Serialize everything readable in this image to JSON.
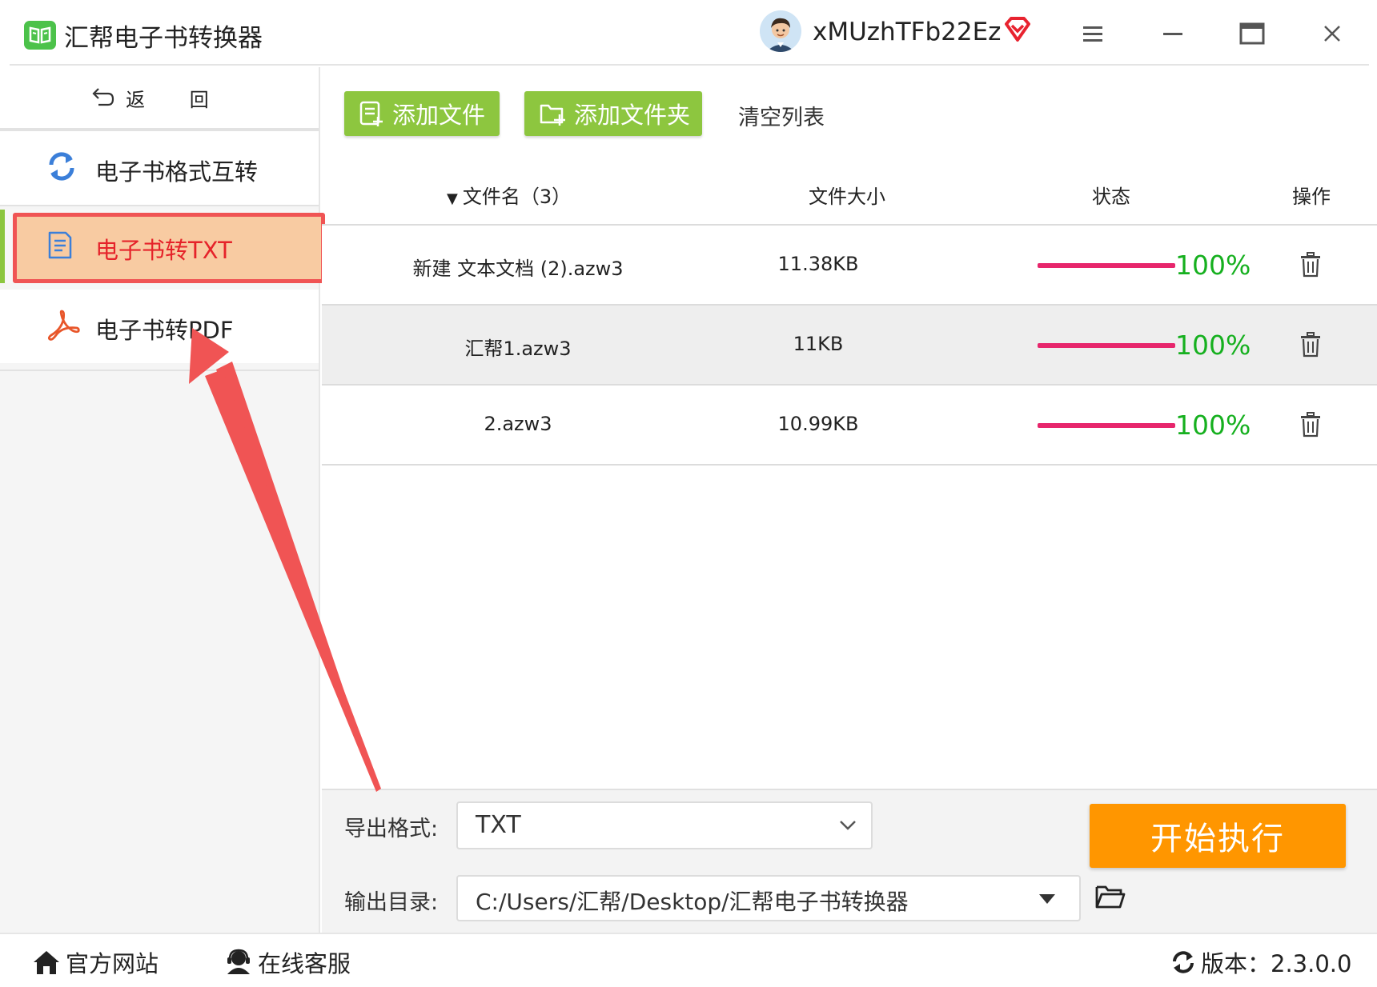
{
  "window": {
    "title": "汇帮电子书转换器",
    "username": "xMUzhTFb22Ez"
  },
  "sidebar": {
    "back_label": "返 回",
    "items": [
      {
        "label": "电子书格式互转",
        "icon": "sync-icon"
      },
      {
        "label": "电子书转TXT",
        "icon": "document-icon"
      },
      {
        "label": "电子书转PDF",
        "icon": "acrobat-pdf-icon"
      }
    ],
    "active_index": 1
  },
  "toolbar": {
    "add_file": "添加文件",
    "add_folder": "添加文件夹",
    "clear_list": "清空列表"
  },
  "table": {
    "headers": {
      "name": "文件名（3）",
      "size": "文件大小",
      "status": "状态",
      "action": "操作"
    },
    "rows": [
      {
        "name": "新建 文本文档 (2).azw3",
        "size": "11.38KB",
        "progress": 1.0,
        "percent": "100%"
      },
      {
        "name": "汇帮1.azw3",
        "size": "11KB",
        "progress": 1.0,
        "percent": "100%"
      },
      {
        "name": "2.azw3",
        "size": "10.99KB",
        "progress": 1.0,
        "percent": "100%"
      }
    ]
  },
  "output": {
    "format_label": "导出格式:",
    "format_value": "TXT",
    "dir_label": "输出目录:",
    "dir_value": "C:/Users/汇帮/Desktop/汇帮电子书转换器",
    "start_button": "开始执行"
  },
  "footer": {
    "website": "官方网站",
    "support": "在线客服",
    "version": "版本：2.3.0.0"
  },
  "colors": {
    "green_button": "#8dc63f",
    "start_button": "#ff9600",
    "progress_bar": "#e7266c",
    "percent_text": "#16b01f",
    "active_label": "#e5232a",
    "highlight_fill": "#f8cba2",
    "highlight_border": "#f05454"
  }
}
